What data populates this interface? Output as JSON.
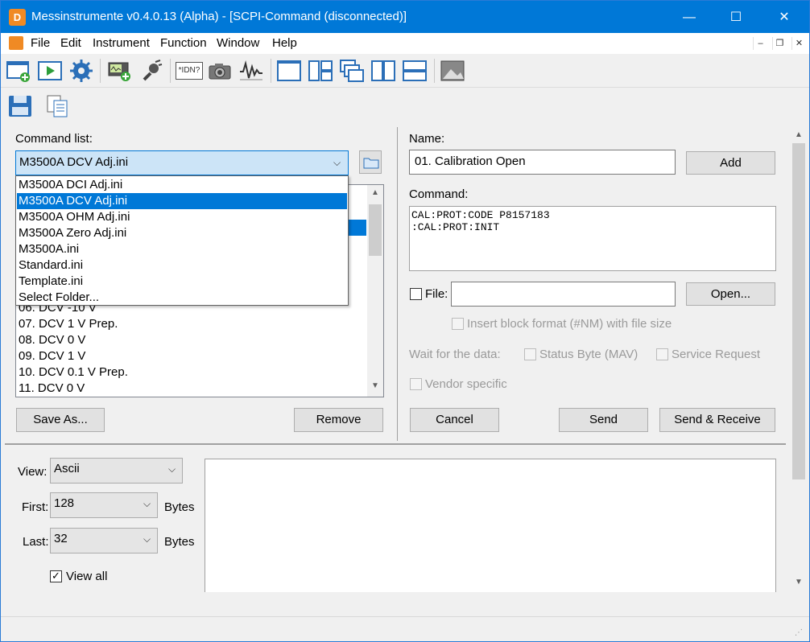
{
  "window": {
    "title": "Messinstrumente v0.4.0.13 (Alpha) - [SCPI-Command (disconnected)]",
    "app_icon": "D",
    "controls": {
      "minimize": "—",
      "maximize": "☐",
      "close": "✕"
    }
  },
  "menu": {
    "items": [
      "File",
      "Edit",
      "Instrument",
      "Function",
      "Window",
      "Help"
    ],
    "mdi_controls": {
      "minimize": "–",
      "restore": "❐",
      "close": "✕"
    }
  },
  "toolbar": {
    "icons": [
      "new-window-icon",
      "run-icon",
      "settings-icon",
      "instrument-add-icon",
      "connect-icon",
      "idn-icon",
      "camera-icon",
      "waveform-icon",
      "layout-single-icon",
      "layout-grid-icon",
      "layout-cascade-icon",
      "layout-vertical-icon",
      "layout-horizontal-icon",
      "screenshot-icon"
    ],
    "idn_label": "*IDN?"
  },
  "toolbar2": {
    "icons": [
      "save-icon",
      "copy-icon"
    ]
  },
  "left": {
    "command_list_label": "Command list:",
    "selected_file": "M3500A DCV Adj.ini",
    "dropdown_options": [
      "M3500A DCI Adj.ini",
      "M3500A DCV Adj.ini",
      "M3500A OHM Adj.ini",
      "M3500A Zero Adj.ini",
      "M3500A.ini",
      "Standard.ini",
      "Template.ini",
      "Select Folder..."
    ],
    "dropdown_selected_index": 1,
    "visible_commands": [
      "06. DCV -10 V",
      "07. DCV 1 V Prep.",
      "08. DCV 0 V",
      "09. DCV 1 V",
      "10. DCV 0.1 V Prep.",
      "11. DCV 0 V"
    ],
    "save_as_label": "Save As...",
    "remove_label": "Remove"
  },
  "right": {
    "name_label": "Name:",
    "name_value": "01. Calibration Open",
    "add_label": "Add",
    "command_label": "Command:",
    "command_lines": [
      "CAL:PROT:CODE P8157183",
      ":CAL:PROT:INIT"
    ],
    "file_label": "File:",
    "file_value": "",
    "open_label": "Open...",
    "block_format_label": "Insert block format (#NM) with file size",
    "wait_label": "Wait for the data:",
    "status_byte_label": "Status Byte (MAV)",
    "service_request_label": "Service Request",
    "vendor_specific_label": "Vendor specific",
    "cancel_label": "Cancel",
    "send_label": "Send",
    "send_receive_label": "Send & Receive"
  },
  "bottom": {
    "view_label": "View:",
    "view_value": "Ascii",
    "first_label": "First:",
    "first_value": "128",
    "last_label": "Last:",
    "last_value": "32",
    "bytes_label": "Bytes",
    "view_all_label": "View all",
    "view_all_checked": true
  }
}
